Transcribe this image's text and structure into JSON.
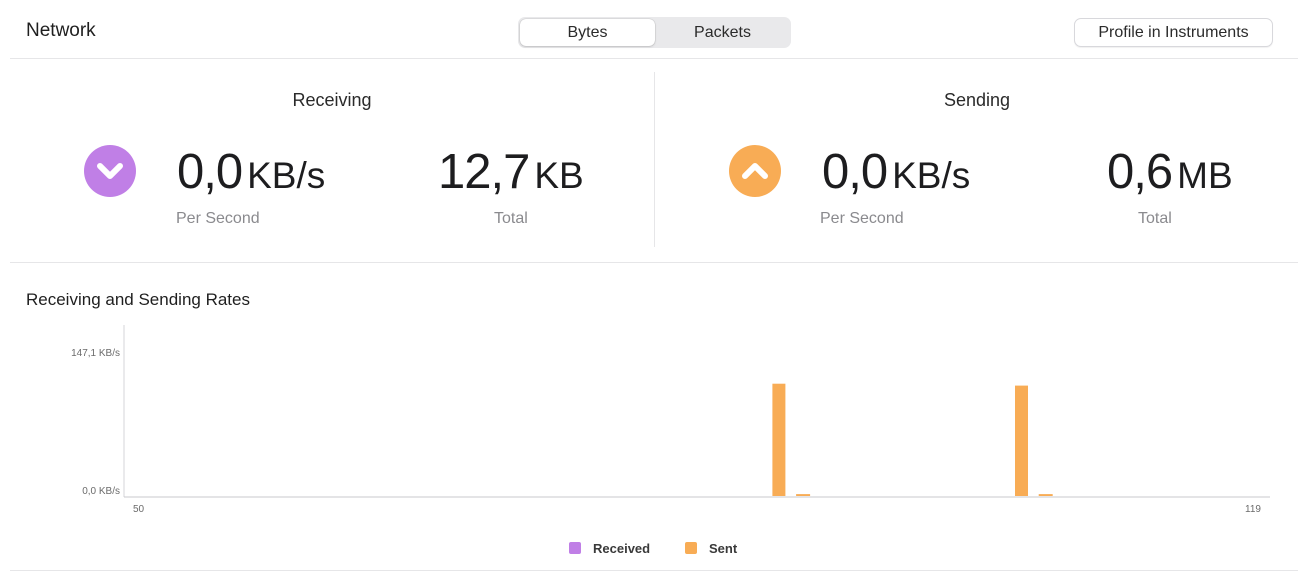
{
  "header": {
    "title": "Network",
    "segments": [
      "Bytes",
      "Packets"
    ],
    "selected_segment": "Bytes",
    "profile_button": "Profile in Instruments"
  },
  "receiving": {
    "title": "Receiving",
    "rate_value": "0,0",
    "rate_unit": "KB/s",
    "rate_caption": "Per Second",
    "total_value": "12,7",
    "total_unit": "KB",
    "total_caption": "Total",
    "icon": "chevron-down-circle-icon",
    "color": "#c07fe6"
  },
  "sending": {
    "title": "Sending",
    "rate_value": "0,0",
    "rate_unit": "KB/s",
    "rate_caption": "Per Second",
    "total_value": "0,6",
    "total_unit": "MB",
    "total_caption": "Total",
    "icon": "chevron-up-circle-icon",
    "color": "#f8ac55"
  },
  "chart_data": {
    "type": "bar",
    "title": "Receiving and Sending Rates",
    "ytick_labels": [
      "147,1 KB/s",
      "0,0 KB/s"
    ],
    "ylim": [
      0,
      147.1
    ],
    "yunit": "KB/s",
    "xtick_labels": [
      "50",
      "119"
    ],
    "xlim": [
      50,
      119
    ],
    "grid": false,
    "legend_position": "bottom-center",
    "series": [
      {
        "name": "Received",
        "color": "#c07fe6",
        "points": []
      },
      {
        "name": "Sent",
        "color": "#f8ac55",
        "points": [
          {
            "x": 89.5,
            "y": 118
          },
          {
            "x": 91,
            "y": 2
          },
          {
            "x": 104.5,
            "y": 116
          },
          {
            "x": 106,
            "y": 2
          }
        ]
      }
    ]
  }
}
